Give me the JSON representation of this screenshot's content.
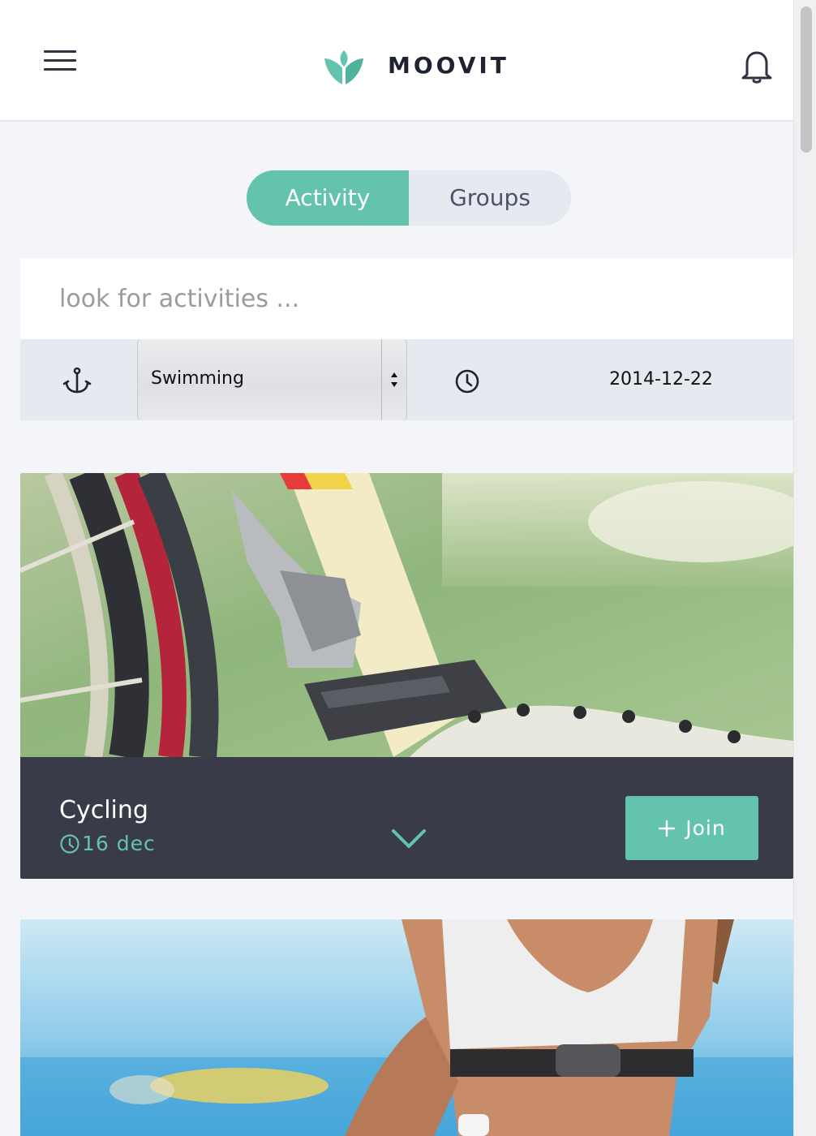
{
  "header": {
    "logo_text": "MOOVIT",
    "menu_icon": "hamburger-menu-icon",
    "notification_icon": "bell-icon"
  },
  "tabs": [
    {
      "label": "Activity",
      "active": true
    },
    {
      "label": "Groups",
      "active": false
    }
  ],
  "search": {
    "placeholder": "look for activities ...",
    "value": ""
  },
  "filters": {
    "category_icon": "anchor-icon",
    "category_value": "Swimming",
    "time_icon": "clock-icon",
    "date_value": "2014-12-22"
  },
  "cards": [
    {
      "title": "Cycling",
      "date": "16 dec",
      "join_label": "Join",
      "expand_icon": "chevron-down-icon",
      "image": "bicycle-gear-photo"
    },
    {
      "image": "runner-beach-photo"
    }
  ],
  "colors": {
    "accent": "#63c3ac",
    "card_bar": "#393b48",
    "background": "#f4f5f8",
    "filter_bar": "#e7e9f0"
  }
}
